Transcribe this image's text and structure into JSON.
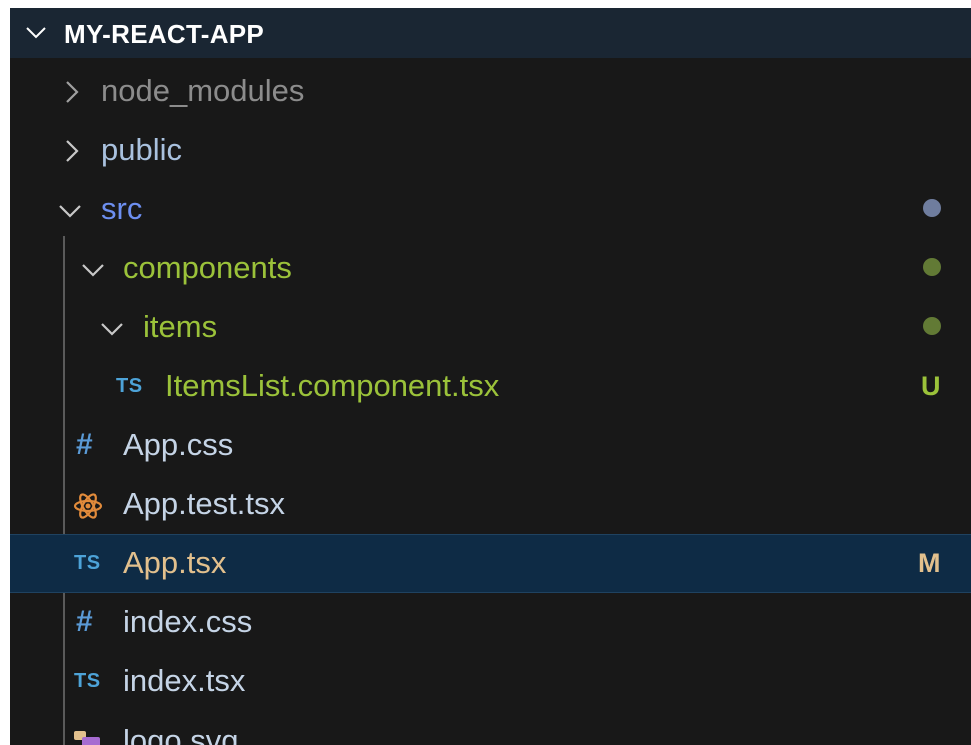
{
  "explorer": {
    "project_title": "MY-REACT-APP",
    "items": [
      {
        "name": "node_modules"
      },
      {
        "name": "public"
      },
      {
        "name": "src"
      },
      {
        "name": "components"
      },
      {
        "name": "items"
      },
      {
        "name": "ItemsList.component.tsx",
        "icon_text": "TS",
        "badge": "U"
      },
      {
        "name": "App.css",
        "icon_text": "#"
      },
      {
        "name": "App.test.tsx",
        "icon": "react-icon"
      },
      {
        "name": "App.tsx",
        "icon_text": "TS",
        "badge": "M"
      },
      {
        "name": "index.css",
        "icon_text": "#"
      },
      {
        "name": "index.tsx",
        "icon_text": "TS"
      },
      {
        "name": "logo.svg",
        "icon": "svg-file-icon"
      }
    ]
  },
  "colors": {
    "background": "#181818",
    "header_bg": "#1a2633",
    "selected_bg": "#0e2b45",
    "ignored_text": "#8c8c8c",
    "folder_text": "#a9c1de",
    "src_text": "#6d8ff0",
    "untracked_green": "#9bc23a",
    "file_text": "#c5d4e6",
    "ts_blue": "#4da3d8",
    "modified_text": "#e2c08d",
    "hash_blue": "#5a9ad6",
    "react_orange": "#e28b3b",
    "svg_purple": "#a66bd1"
  }
}
